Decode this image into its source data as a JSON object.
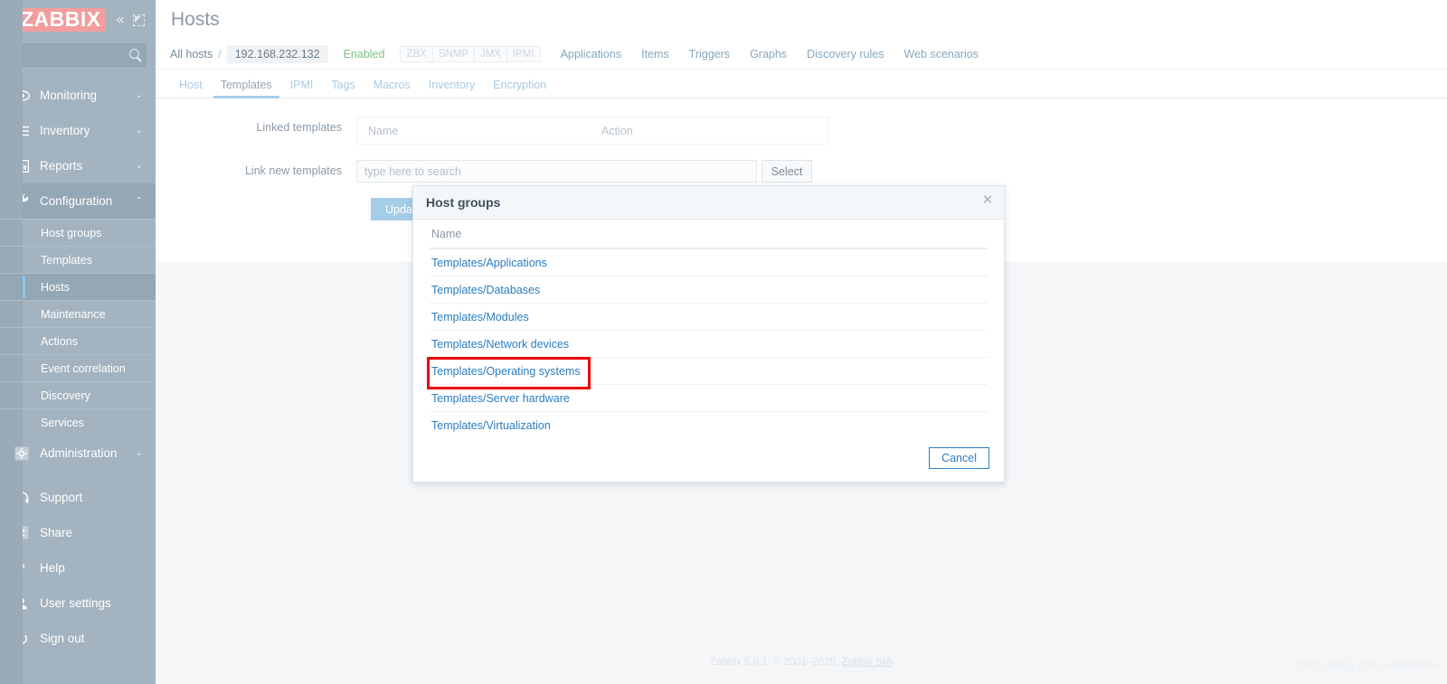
{
  "brand": {
    "logo": "ZABBIX",
    "logo_bg": "#f29d9d",
    "collapse_icon": "«",
    "hide_icon": "hide-sidebar-icon"
  },
  "sidebar": {
    "bg": "#a3b3bf",
    "search": {
      "value": "",
      "placeholder": ""
    },
    "menu": [
      {
        "label": "Monitoring",
        "icon": "eye-icon",
        "chevron": "⌄",
        "expanded": false
      },
      {
        "label": "Inventory",
        "icon": "list-icon",
        "chevron": "⌄",
        "expanded": false
      },
      {
        "label": "Reports",
        "icon": "bar-chart-icon",
        "chevron": "⌄",
        "expanded": false
      },
      {
        "label": "Configuration",
        "icon": "wrench-icon",
        "chevron": "⌃",
        "expanded": true
      }
    ],
    "configuration_submenu": [
      {
        "label": "Host groups",
        "selected": false
      },
      {
        "label": "Templates",
        "selected": false
      },
      {
        "label": "Hosts",
        "selected": true
      },
      {
        "label": "Maintenance",
        "selected": false
      },
      {
        "label": "Actions",
        "selected": false
      },
      {
        "label": "Event correlation",
        "selected": false
      },
      {
        "label": "Discovery",
        "selected": false
      },
      {
        "label": "Services",
        "selected": false
      }
    ],
    "administration": {
      "label": "Administration",
      "icon": "gear-icon",
      "chevron": "⌄"
    },
    "bottom": [
      {
        "label": "Support",
        "icon": "headset-icon"
      },
      {
        "label": "Share",
        "icon": "zabbix-share-icon"
      },
      {
        "label": "Help",
        "icon": "question-icon"
      },
      {
        "label": "User settings",
        "icon": "user-icon"
      },
      {
        "label": "Sign out",
        "icon": "power-icon"
      }
    ]
  },
  "header": {
    "title": "Hosts"
  },
  "breadcrumb": {
    "all_hosts": "All hosts",
    "separator": "/",
    "host": "192.168.232.132",
    "status": "Enabled",
    "status_color": "#7fc08a",
    "interfaces": [
      "ZBX",
      "SNMP",
      "JMX",
      "IPMI"
    ],
    "links": [
      "Applications",
      "Items",
      "Triggers",
      "Graphs",
      "Discovery rules",
      "Web scenarios"
    ]
  },
  "tabs": [
    {
      "label": "Host",
      "active": false
    },
    {
      "label": "Templates",
      "active": true
    },
    {
      "label": "IPMI",
      "active": false
    },
    {
      "label": "Tags",
      "active": false
    },
    {
      "label": "Macros",
      "active": false
    },
    {
      "label": "Inventory",
      "active": false
    },
    {
      "label": "Encryption",
      "active": false
    }
  ],
  "form": {
    "linked_templates": {
      "label": "Linked templates",
      "columns": [
        "Name",
        "Action"
      ]
    },
    "link_new_templates": {
      "label": "Link new templates",
      "input_value": "",
      "input_placeholder": "type here to search",
      "select_button": "Select"
    },
    "update_button": "Update"
  },
  "modal": {
    "title": "Host groups",
    "close_icon": "close-icon",
    "column_header": "Name",
    "rows": [
      {
        "name": "Templates/Applications",
        "flagged": false
      },
      {
        "name": "Templates/Databases",
        "flagged": false
      },
      {
        "name": "Templates/Modules",
        "flagged": false
      },
      {
        "name": "Templates/Network devices",
        "flagged": false
      },
      {
        "name": "Templates/Operating systems",
        "flagged": true
      },
      {
        "name": "Templates/Server hardware",
        "flagged": false
      },
      {
        "name": "Templates/Virtualization",
        "flagged": false
      }
    ],
    "cancel_button": "Cancel",
    "highlight_color": "#ef0000",
    "link_color": "#2b7cc0"
  },
  "footer": {
    "text": "Zabbix 5.0.1. © 2001–2020, ",
    "link": "Zabbix SIA"
  },
  "watermark": "https://blog.csdn.net/Insistw"
}
